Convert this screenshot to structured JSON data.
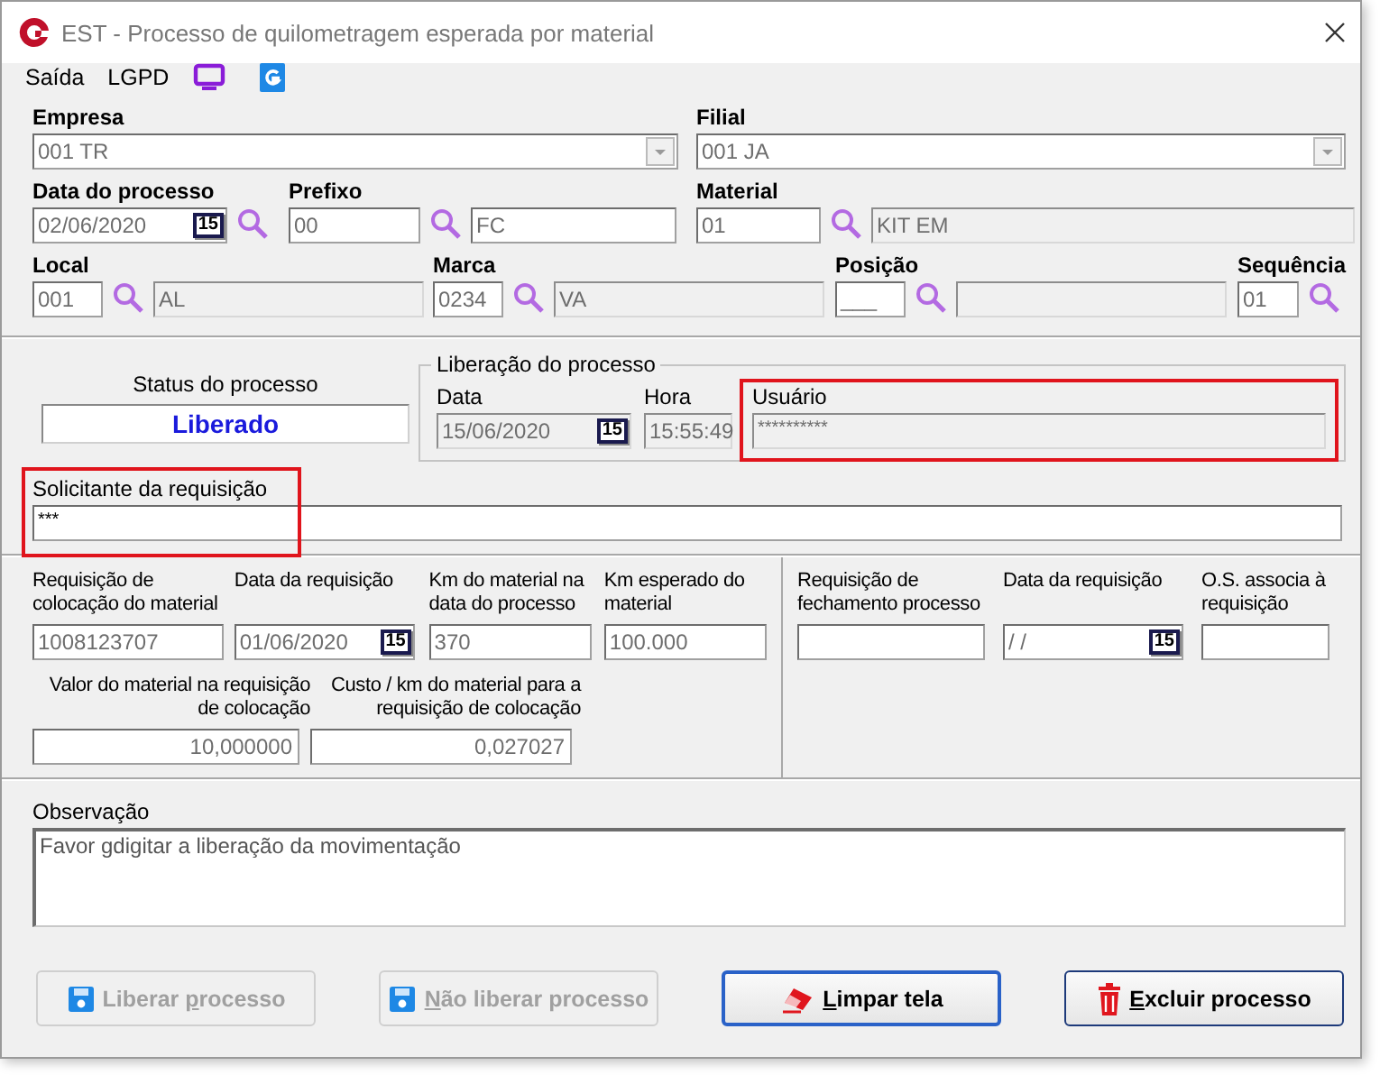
{
  "window": {
    "title": "EST - Processo de quilometragem esperada por material"
  },
  "menu": [
    {
      "label": "Saída"
    },
    {
      "label": "LGPD"
    }
  ],
  "empresa": {
    "label": "Empresa",
    "value": "001 TR"
  },
  "filial": {
    "label": "Filial",
    "value": "001 JA"
  },
  "data_processo": {
    "label": "Data do processo",
    "value": "02/06/2020",
    "calendar": "15"
  },
  "prefixo": {
    "label": "Prefixo",
    "code": "00",
    "description": "FC"
  },
  "material": {
    "label": "Material",
    "code": "01",
    "description": "KIT EM"
  },
  "local": {
    "label": "Local",
    "code": "001",
    "description": "AL"
  },
  "marca": {
    "label": "Marca",
    "code": "0234",
    "description": "VA"
  },
  "posicao": {
    "label": "Posição",
    "code": "___"
  },
  "sequencia": {
    "label": "Sequência",
    "code": "01"
  },
  "status": {
    "label": "Status do processo",
    "value": "Liberado"
  },
  "liberacao": {
    "title": "Liberação do processo",
    "data_label": "Data",
    "data": "15/06/2020",
    "calendar": "15",
    "hora_label": "Hora",
    "hora": "15:55:49",
    "usuario_label": "Usuário",
    "usuario": "**********",
    "highlighted": true
  },
  "solicitante": {
    "label": "Solicitante da requisição",
    "value": "***",
    "highlighted": true
  },
  "colocacao": [
    {
      "label": "Requisição de colocação do material",
      "value": "1008123707"
    },
    {
      "label": "Data da requisição",
      "value": "01/06/2020",
      "calendar": "15"
    },
    {
      "label": "Km do material na data do processo",
      "value": "370"
    },
    {
      "label": "Km esperado do material",
      "value": "100.000"
    }
  ],
  "valores": [
    {
      "label": "Valor do material na requisição de colocação",
      "value": "10,000000"
    },
    {
      "label": "Custo / km do material para a requisição de colocação",
      "value": "0,027027"
    }
  ],
  "fechamento": [
    {
      "label": "Requisição de fechamento processo"
    },
    {
      "label": "Data da requisição",
      "value": " /  /",
      "calendar": "15"
    },
    {
      "label": "O.S. associa à requisição"
    }
  ],
  "observacao": {
    "label": "Observação",
    "value": "Favor gdigitar a liberação da movimentação"
  },
  "buttons": [
    {
      "kind": "save",
      "before": "Liberar ",
      "key": "p",
      "after": "rocesso",
      "disabled": true,
      "focused": false
    },
    {
      "kind": "save",
      "key": "N",
      "after": "ão liberar processo",
      "disabled": true,
      "focused": false
    },
    {
      "kind": "eraser",
      "key": "L",
      "after": "impar tela",
      "disabled": false,
      "focused": true
    },
    {
      "kind": "trash",
      "key": "E",
      "after": "xcluir processo",
      "disabled": false,
      "focused": false
    }
  ]
}
